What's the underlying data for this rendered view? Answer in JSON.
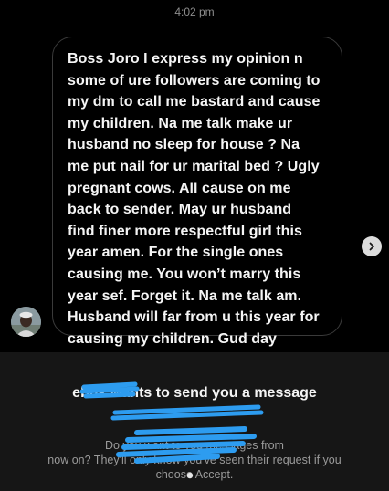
{
  "status_bar": {
    "time": "4:02 pm"
  },
  "message": {
    "lines": [
      "Boss Joro I express my opinion n",
      "some of ure followers are coming to",
      "my dm to call me bastard and cause",
      "my children. Na me talk make ur",
      "husband no sleep for house ? Na",
      "me put nail for ur marital bed ? Ugly",
      "pregnant cows. All cause on me",
      "back to sender. May ur husband",
      "find finer more respectful girl this",
      "year amen. For the single ones",
      "causing me. You won’t marry this",
      "year sef. Forget it. Na me talk am.",
      "Husband will far from u this year for",
      "causing my children. Gud day"
    ]
  },
  "request": {
    "title": "ebuk          wants to send you a message",
    "subtitle_line1": "Do you want to                              you messages from",
    "subtitle_line2": "now on? They'll only know you've seen their request if you",
    "subtitle_line3": "choose Accept."
  },
  "colors": {
    "background": "#000000",
    "panel": "#161616",
    "redaction": "#2d9cf0",
    "bubble_border": "#3a3a3a"
  },
  "icons": {
    "forward": "chevron-right-icon",
    "avatar": "profile-avatar"
  }
}
